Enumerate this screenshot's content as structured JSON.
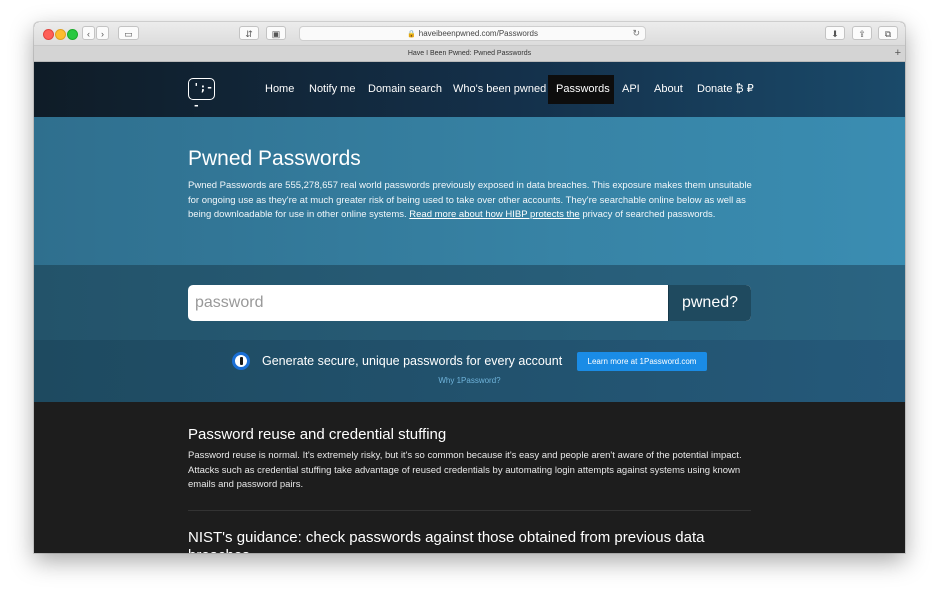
{
  "browser": {
    "url": "haveibeenpwned.com/Passwords",
    "tab_title": "Have I Been Pwned: Pwned Passwords",
    "new_tab_symbol": "+"
  },
  "nav": {
    "logo_text": "';--",
    "items": [
      {
        "label": "Home"
      },
      {
        "label": "Notify me"
      },
      {
        "label": "Domain search"
      },
      {
        "label": "Who's been pwned"
      },
      {
        "label": "Passwords"
      },
      {
        "label": "API"
      },
      {
        "label": "About"
      },
      {
        "label": "Donate ₿ ₽"
      }
    ],
    "active": "Passwords"
  },
  "hero": {
    "title": "Pwned Passwords",
    "body": "Pwned Passwords are 555,278,657 real world passwords previously exposed in data breaches. This exposure makes them unsuitable for ongoing use as they're at much greater risk of being used to take over other accounts. They're searchable online below as well as being downloadable for use in other online systems. ",
    "link": "Read more about how HIBP protects the",
    "body_end": "privacy of searched passwords."
  },
  "search": {
    "placeholder": "password",
    "button_label": "pwned?"
  },
  "promo": {
    "text": "Generate secure, unique passwords for every account",
    "button_label": "Learn more at 1Password.com",
    "why_link": "Why 1Password?"
  },
  "sections": [
    {
      "title": "Password reuse and credential stuffing",
      "body": "Password reuse is normal. It's extremely risky, but it's so common because it's easy and people aren't aware of the potential impact. Attacks such as credential stuffing take advantage of reused credentials by automating login attempts against systems using known emails and password pairs."
    },
    {
      "title": "NIST's guidance: check passwords against those obtained from previous data breaches"
    }
  ],
  "colors": {
    "nav_active_bg": "#0d0d0d",
    "hero_bg": "#3783a5",
    "promo_button": "#1a8ce6",
    "pwned_button": "#1f4a5f"
  }
}
